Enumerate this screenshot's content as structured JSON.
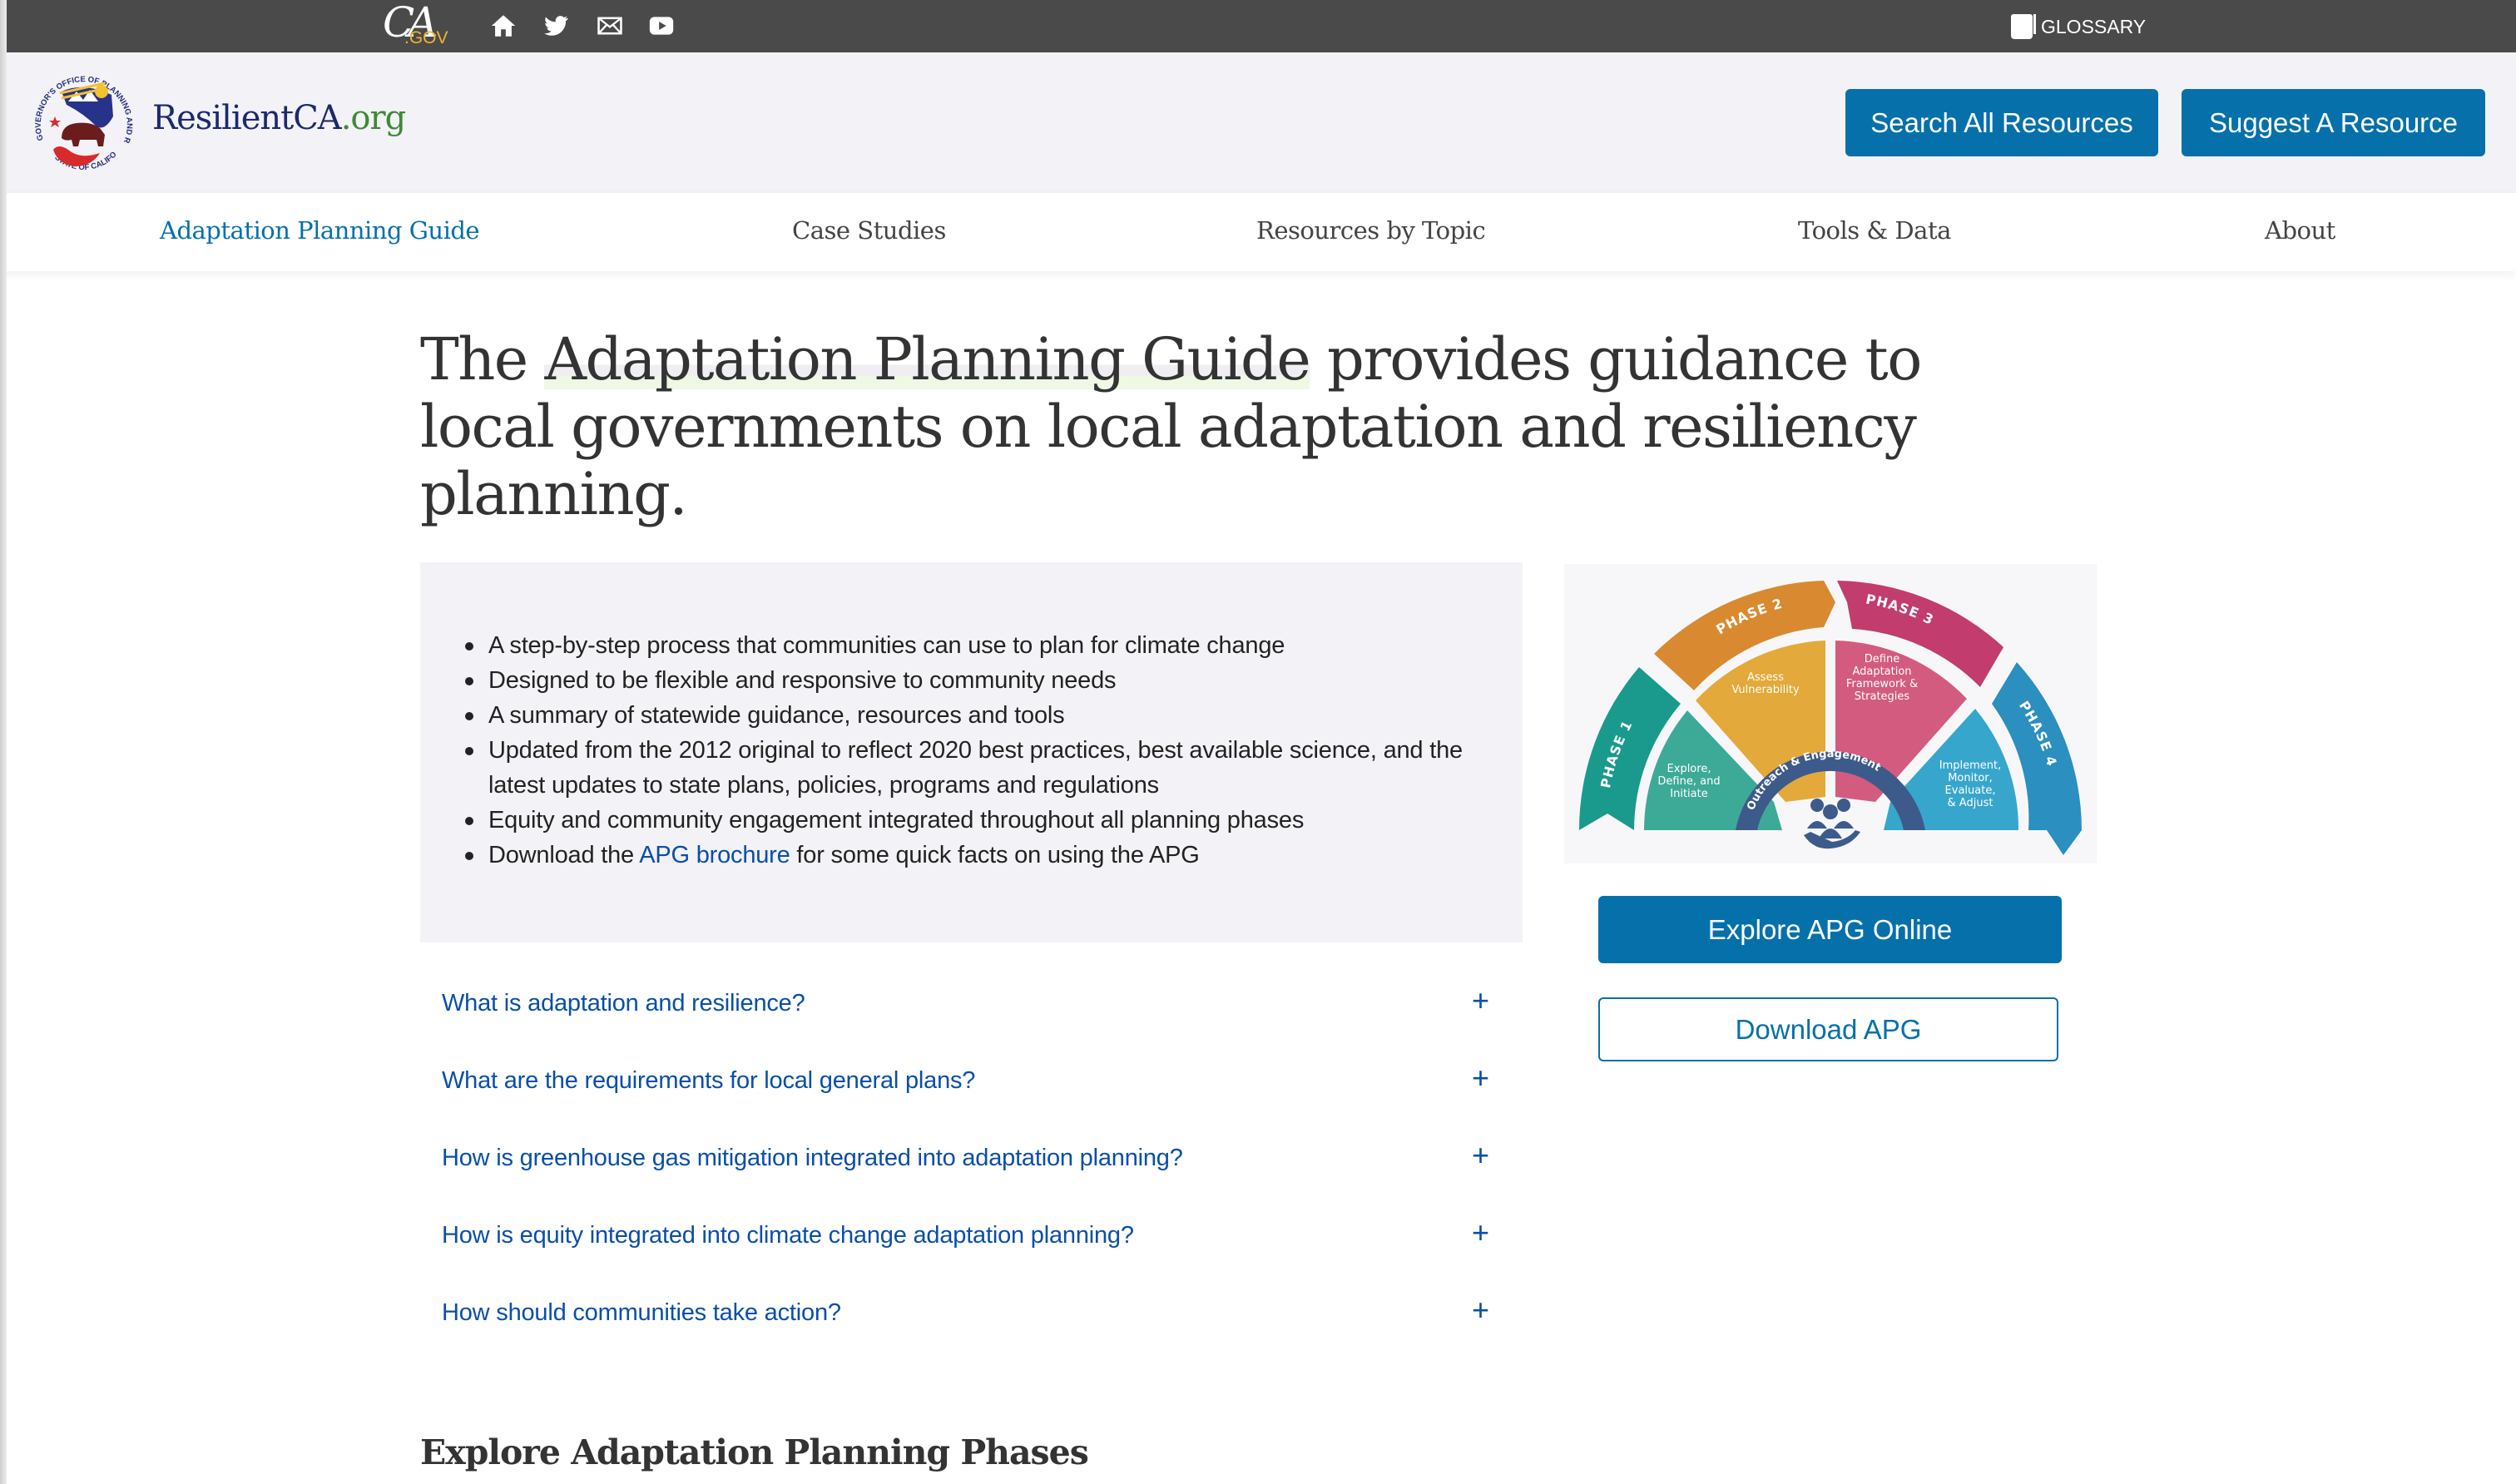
{
  "topbar": {
    "ca_logo_main": "CA",
    "ca_logo_suffix": ".GOV",
    "icons": [
      "home-icon",
      "twitter-icon",
      "email-icon",
      "youtube-icon"
    ],
    "glossary_label": "GLOSSARY"
  },
  "header": {
    "brand_name": "ResilientCA",
    "brand_tld": ".org",
    "seal_top_text": "GOVERNOR'S OFFICE OF PLANNING AND RESEARCH",
    "seal_bottom_text": "STATE OF CALIFORNIA",
    "search_button": "Search All Resources",
    "suggest_button": "Suggest A Resource"
  },
  "nav": {
    "items": [
      {
        "label": "Adaptation Planning Guide",
        "active": true
      },
      {
        "label": "Case Studies",
        "active": false
      },
      {
        "label": "Resources by Topic",
        "active": false
      },
      {
        "label": "Tools & Data",
        "active": false
      },
      {
        "label": "About",
        "active": false
      }
    ]
  },
  "main": {
    "lede_prefix": "The ",
    "lede_highlight": "Adaptation Planning Guide",
    "lede_suffix": " provides guidance to local governments on local adaptation and resiliency planning.",
    "bullets": [
      "A step-by-step process that communities can use to plan for climate change",
      "Designed to be flexible and responsive to community needs",
      "A summary of statewide guidance, resources and tools",
      "Updated from the 2012 original to reflect 2020 best practices, best available science, and the latest updates to state plans, policies, programs and regulations",
      "Equity and community engagement integrated throughout all planning phases"
    ],
    "last_bullet": {
      "prefix": "Download the ",
      "link": "APG brochure",
      "suffix": " for some quick facts on using the APG"
    },
    "accordion": [
      {
        "question": "What is adaptation and resilience?",
        "icon": "+"
      },
      {
        "question": "What are the requirements for local general plans?",
        "icon": "+"
      },
      {
        "question": "How is greenhouse gas mitigation integrated into adaptation planning?",
        "icon": "+"
      },
      {
        "question": "How is equity integrated into climate change adaptation planning?",
        "icon": "+"
      },
      {
        "question": "How should communities take action?",
        "icon": "+"
      }
    ],
    "section_heading": "Explore Adaptation Planning Phases"
  },
  "diagram": {
    "phases": [
      {
        "label": "PHASE 1",
        "text": [
          "Explore,",
          "Define, and",
          "Initiate"
        ],
        "color": "#1a9a8c",
        "inner": "#3daa98"
      },
      {
        "label": "PHASE 2",
        "text": [
          "Assess",
          "Vulnerability"
        ],
        "color": "#d98a30",
        "inner": "#e3a93a"
      },
      {
        "label": "PHASE 3",
        "text": [
          "Define",
          "Adaptation",
          "Framework &",
          "Strategies"
        ],
        "color": "#c23c6e",
        "inner": "#d45b80"
      },
      {
        "label": "PHASE 4",
        "text": [
          "Implement,",
          "Monitor,",
          "Evaluate,",
          "& Adjust"
        ],
        "color": "#2b8fbf",
        "inner": "#37a6cc"
      }
    ],
    "center_label": "Outreach & Engagement",
    "center_color": "#3d5b8a"
  },
  "sidebar": {
    "explore_button": "Explore APG Online",
    "download_button": "Download APG"
  },
  "colors": {
    "topbar_bg": "#4a4a4a",
    "header_bg": "#f3f2f6",
    "primary_blue": "#0670ab",
    "link_blue": "#0a4ea8",
    "gov_gold": "#f2b530"
  }
}
